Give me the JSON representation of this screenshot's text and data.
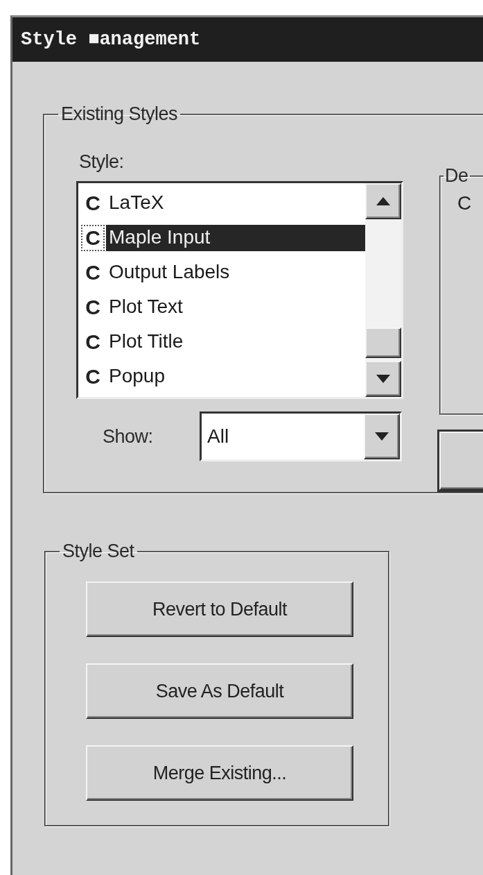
{
  "window": {
    "title": "Style ■anagement"
  },
  "existing_styles": {
    "title": "Existing Styles",
    "style_label": "Style:",
    "styles": [
      {
        "marker": "C",
        "name": "LaTeX",
        "selected": false
      },
      {
        "marker": "C",
        "name": "Maple Input",
        "selected": true
      },
      {
        "marker": "C",
        "name": "Output Labels",
        "selected": false
      },
      {
        "marker": "C",
        "name": "Plot Text",
        "selected": false
      },
      {
        "marker": "C",
        "name": "Plot Title",
        "selected": false
      },
      {
        "marker": "C",
        "name": "Popup",
        "selected": false
      }
    ],
    "show_label": "Show:",
    "show_value": "All",
    "details_group": {
      "title": "De",
      "text": "C"
    }
  },
  "style_set": {
    "title": "Style Set",
    "buttons": [
      "Revert to Default",
      "Save As Default",
      "Merge Existing..."
    ]
  }
}
